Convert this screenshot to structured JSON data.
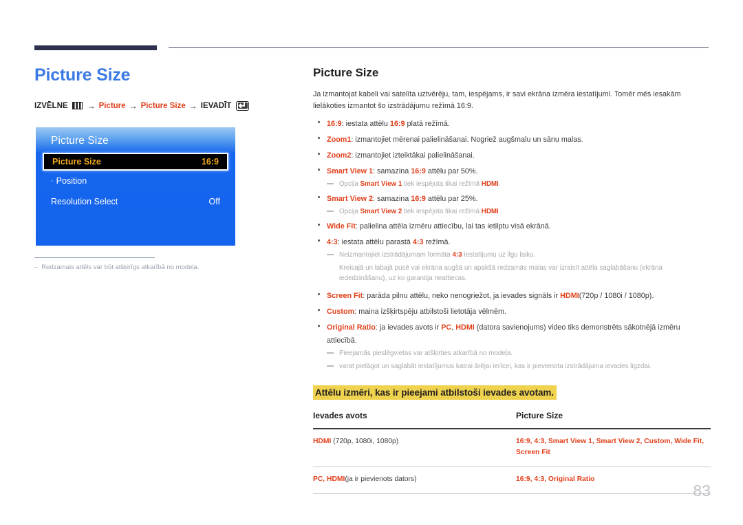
{
  "header": {
    "left_bar_color": "#2e3050",
    "right_rule_color": "#45485f"
  },
  "left": {
    "title": "Picture Size",
    "breadcrumb": {
      "menu_label": "IZVĒLNE",
      "menu_icon": "menu-icon",
      "arrow": "→",
      "item1": "Picture",
      "item2": "Picture Size",
      "enter_label": "IEVADĪT",
      "enter_icon": "enter-key-icon"
    },
    "osd": {
      "title": "Picture Size",
      "selected_row": {
        "label": "Picture Size",
        "value": "16:9"
      },
      "rows": [
        {
          "label": "Position",
          "value": "",
          "sub": true
        },
        {
          "label": "Resolution Select",
          "value": "Off",
          "sub": false
        }
      ]
    },
    "note": "Redzamais attēls var būt atšķirīgs atkarībā no modeļa.",
    "note_dash": "–"
  },
  "right": {
    "title": "Picture Size",
    "intro": "Ja izmantojat kabeli vai satelīta uztvērēju, tam, iespējams, ir savi ekrāna izmēra iestatījumi. Tomēr mēs iesakām lielākoties izmantot šo izstrādājumu režīmā 16:9.",
    "bullets": [
      {
        "term": "16:9",
        "rest": ": iestata attēlu ",
        "term2": "16:9",
        "rest2": " platā režīmā."
      },
      {
        "term": "Zoom1",
        "rest": ": izmantojiet mērenai palielināšanai. Nogriež augšmalu un sānu malas."
      },
      {
        "term": "Zoom2",
        "rest": ": izmantojiet izteiktākai palielināšanai."
      },
      {
        "term": "Smart View 1",
        "rest": ": samazina ",
        "term2": "16:9",
        "rest2": " attēlu par 50%."
      },
      {
        "term": "Smart View 2",
        "rest": ": samazina ",
        "term2": "16:9",
        "rest2": " attēlu par 25%."
      },
      {
        "term": "Wide Fit",
        "rest": ": palielina attēla izmēru attiecību, lai tas ietilptu visā ekrānā."
      },
      {
        "term": "4:3",
        "rest": ": iestata attēlu parastā ",
        "term2": "4:3",
        "rest2": " režīmā."
      },
      {
        "term": "Screen Fit",
        "rest": ": parāda pilnu attēlu, neko nenogriežot, ja ievades signāls ir ",
        "term2": "HDMI",
        "rest2": "(720p / 1080i / 1080p)."
      },
      {
        "term": "Custom",
        "rest": ": maina izšķirtspēju atbilstoši lietotāja vēlmēm."
      },
      {
        "term": "Original Ratio",
        "rest": ": ja ievades avots ir ",
        "term2": "PC",
        "mid": ", ",
        "term3": "HDMI",
        "rest2": " (datora savienojums) video tiks demonstrēts sākotnējā izmēru attiecībā."
      }
    ],
    "notes": {
      "smart_view_1": {
        "pre": "Opcija ",
        "kw1": "Smart View 1",
        "mid": " tiek iespējota tikai režīmā ",
        "kw2": "HDMI",
        "post": "."
      },
      "smart_view_2": {
        "pre": "Opcija ",
        "kw1": "Smart View 2",
        "mid": " tiek iespējota tikai režīmā ",
        "kw2": "HDMI",
        "post": " ."
      },
      "ratio43": {
        "pre": "Neizmantojiet izstrādājumam formāta ",
        "kw1": "4:3",
        "post": " iestatījumu uz ilgu laiku.",
        "cont": "Kreisajā un labajā pusē vai ekrāna augšā un apakšā redzamās malas var izraisīt attēla saglabāšanu (ekrāna iededzināšanu), uz ko garantija neattiecas."
      },
      "ports": "Pieejamās pieslēgvietas var atšķirties atkarībā no modeļa.",
      "save": "varat pielāgot un saglabāt iestatījumus katrai ārējai ierīcei, kas ir pievienota izstrādājuma ievades ligzdai."
    },
    "highlight_heading": "Attēlu izmēri, kas ir pieejami atbilstoši ievades avotam.",
    "table": {
      "headers": [
        "Ievades avots",
        "Picture Size"
      ],
      "rows": [
        {
          "source_kw": "HDMI",
          "source_rest": " (720p, 1080i, 1080p)",
          "sizes": "16:9, 4:3, Smart View 1, Smart View 2, Custom, Wide Fit, Screen Fit"
        },
        {
          "source_kw": "PC, HDMI",
          "source_rest": "(ja ir pievienots dators)",
          "sizes": "16:9, 4:3, Original Ratio"
        }
      ]
    }
  },
  "page_number": "83",
  "colors": {
    "accent_red": "#e0401b",
    "title_blue": "#3c7ae4",
    "highlight_yellow": "#efd24e",
    "osd_blue": "#1463ec",
    "osd_gold": "#f0a71e"
  }
}
